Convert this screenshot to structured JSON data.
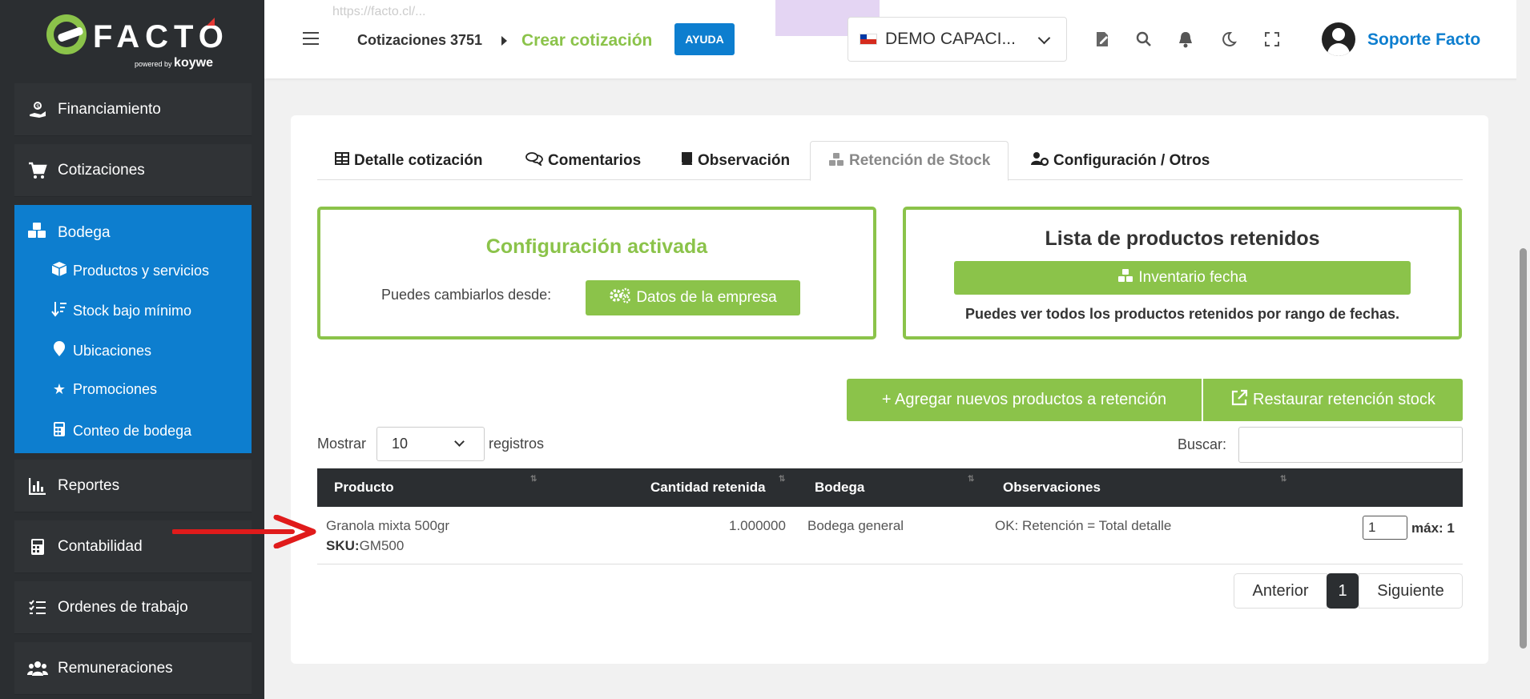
{
  "app": {
    "logo_text": "FACTO",
    "logo_powered": "powered by",
    "logo_brand": "koywe",
    "url_fragment": "https://facto.cl/..."
  },
  "sidebar": {
    "items": [
      {
        "label": "Financiamiento",
        "icon": "hand-coin-icon"
      },
      {
        "label": "Cotizaciones",
        "icon": "cart-icon"
      },
      {
        "label": "Bodega",
        "icon": "cubes-icon"
      },
      {
        "label": "Reportes",
        "icon": "bar-chart-icon"
      },
      {
        "label": "Contabilidad",
        "icon": "calculator-icon"
      },
      {
        "label": "Ordenes de trabajo",
        "icon": "tasks-icon"
      },
      {
        "label": "Remuneraciones",
        "icon": "users-icon"
      }
    ],
    "bodega_sub": [
      {
        "label": "Productos y servicios",
        "icon": "box-icon"
      },
      {
        "label": "Stock bajo mínimo",
        "icon": "sort-down-icon"
      },
      {
        "label": "Ubicaciones",
        "icon": "map-pin-icon"
      },
      {
        "label": "Promociones",
        "icon": "star-icon"
      },
      {
        "label": "Conteo de bodega",
        "icon": "calculator-icon"
      }
    ]
  },
  "header": {
    "breadcrumb_parent": "Cotizaciones 3751",
    "breadcrumb_current": "Crear cotización",
    "help_label": "AYUDA",
    "company": "DEMO CAPACI...",
    "user_name": "Soporte Facto"
  },
  "tabs": [
    {
      "label": "Detalle cotización",
      "icon": "table-icon"
    },
    {
      "label": "Comentarios",
      "icon": "comments-icon"
    },
    {
      "label": "Observación",
      "icon": "book-icon"
    },
    {
      "label": "Retención de Stock",
      "icon": "cubes-icon",
      "active": true
    },
    {
      "label": "Configuración / Otros",
      "icon": "user-gear-icon"
    }
  ],
  "config_box": {
    "title": "Configuración activada",
    "text": "Puedes cambiarlos desde:",
    "button": "Datos de la empresa"
  },
  "retained_box": {
    "title": "Lista de productos retenidos",
    "button": "Inventario fecha",
    "text": "Puedes ver todos los productos retenidos por rango de fechas."
  },
  "actions": {
    "add": "+ Agregar nuevos productos a retención",
    "restore": "Restaurar retención stock"
  },
  "table_controls": {
    "show_label": "Mostrar",
    "show_value": "10",
    "records_label": "registros",
    "search_label": "Buscar:"
  },
  "table": {
    "headers": [
      "Producto",
      "Cantidad retenida",
      "Bodega",
      "Observaciones"
    ],
    "rows": [
      {
        "product": "Granola mixta 500gr",
        "sku_label": "SKU:",
        "sku": "GM500",
        "quantity": "1.000000",
        "bodega": "Bodega general",
        "observation": "OK: Retención = Total detalle",
        "input_value": "1",
        "max_label": "máx: 1"
      }
    ]
  },
  "pagination": {
    "prev": "Anterior",
    "current": "1",
    "next": "Siguiente"
  },
  "colors": {
    "accent_green": "#8bc34a",
    "primary_blue": "#0d7ecf",
    "sidebar_dark": "#2b2e31",
    "annotation_red": "#e01b1b"
  }
}
